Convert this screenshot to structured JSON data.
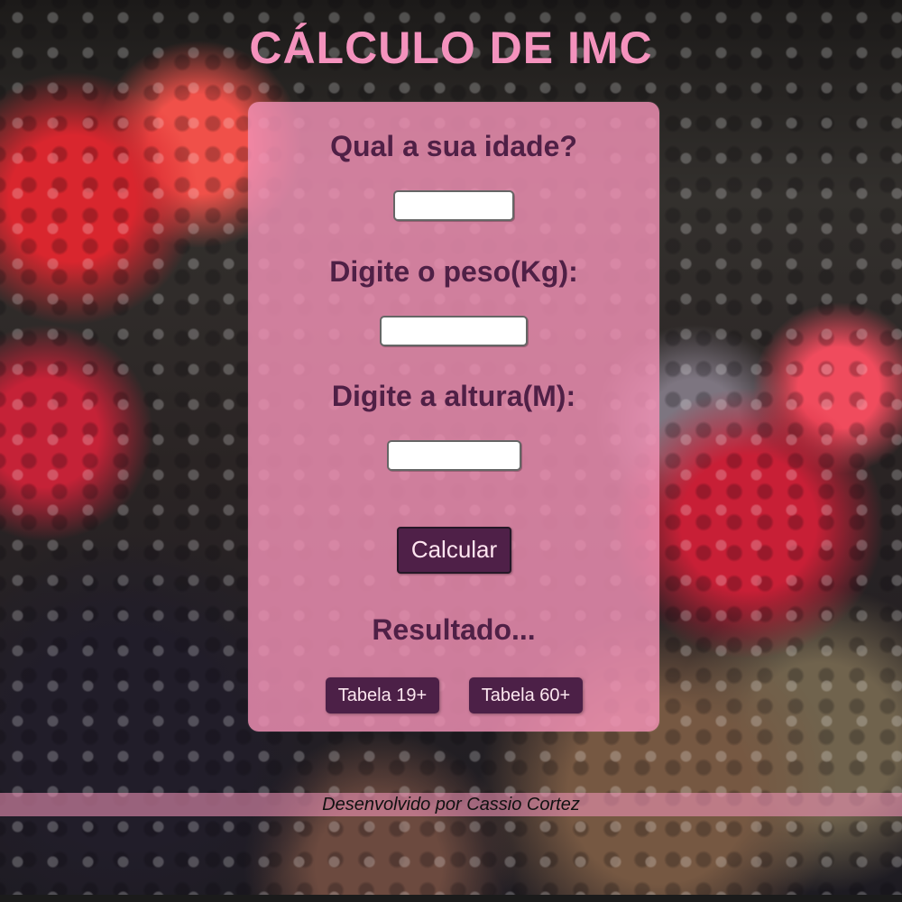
{
  "header": {
    "title": "CÁLCULO DE IMC"
  },
  "form": {
    "age_label": "Qual a sua idade?",
    "weight_label": "Digite o peso(Kg):",
    "height_label": "Digite a altura(M):",
    "age_value": "",
    "weight_value": "",
    "height_value": "",
    "calculate_button": "Calcular",
    "result_text": "Resultado...",
    "table_19_button": "Tabela 19+",
    "table_60_button": "Tabela 60+"
  },
  "footer": {
    "credit": "Desenvolvido por Cassio Cortez"
  },
  "colors": {
    "title_pink": "#f492bd",
    "card_pink": "#f190b5",
    "text_purple": "#4f2046",
    "button_purple": "#4f2048"
  }
}
